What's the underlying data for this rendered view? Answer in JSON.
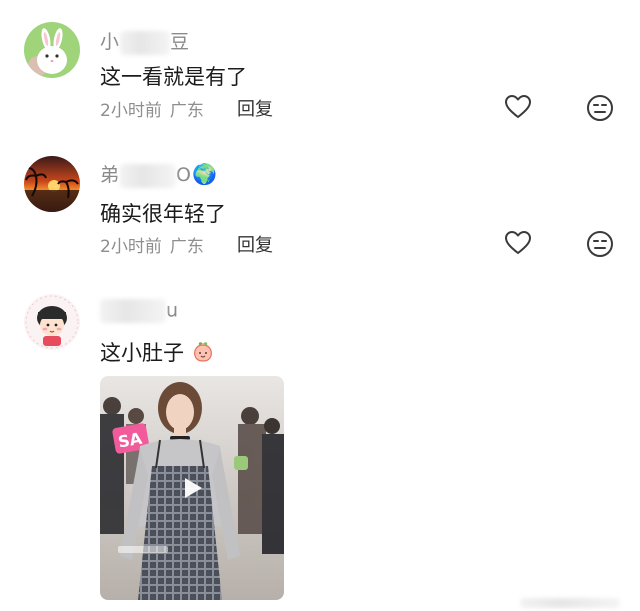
{
  "comments": [
    {
      "username_visible_start": "小",
      "username_visible_end": "豆",
      "text": "这一看就是有了",
      "time": "2小时前",
      "location": "广东",
      "reply_label": "回复",
      "avatar_icon": "white-rabbit-avatar",
      "like_icon": "heart-outline-icon",
      "react_icon": "neutral-face-icon"
    },
    {
      "username_visible_start": "弟",
      "username_visible_end": "O",
      "username_emoji": "🌍",
      "text": "确实很年轻了",
      "time": "2小时前",
      "location": "广东",
      "reply_label": "回复",
      "avatar_icon": "sunset-palm-avatar",
      "like_icon": "heart-outline-icon",
      "react_icon": "neutral-face-icon"
    },
    {
      "username_visible_end": "u",
      "text": "这小肚子",
      "text_emoji": "peach-emoji",
      "avatar_icon": "cartoon-girl-avatar",
      "video_icon": "play-icon"
    }
  ],
  "colors": {
    "meta_gray": "#8e8e8e",
    "username_gray": "#8a8a8a",
    "text": "#1b1b1b",
    "icon": "#3a3a3a"
  }
}
